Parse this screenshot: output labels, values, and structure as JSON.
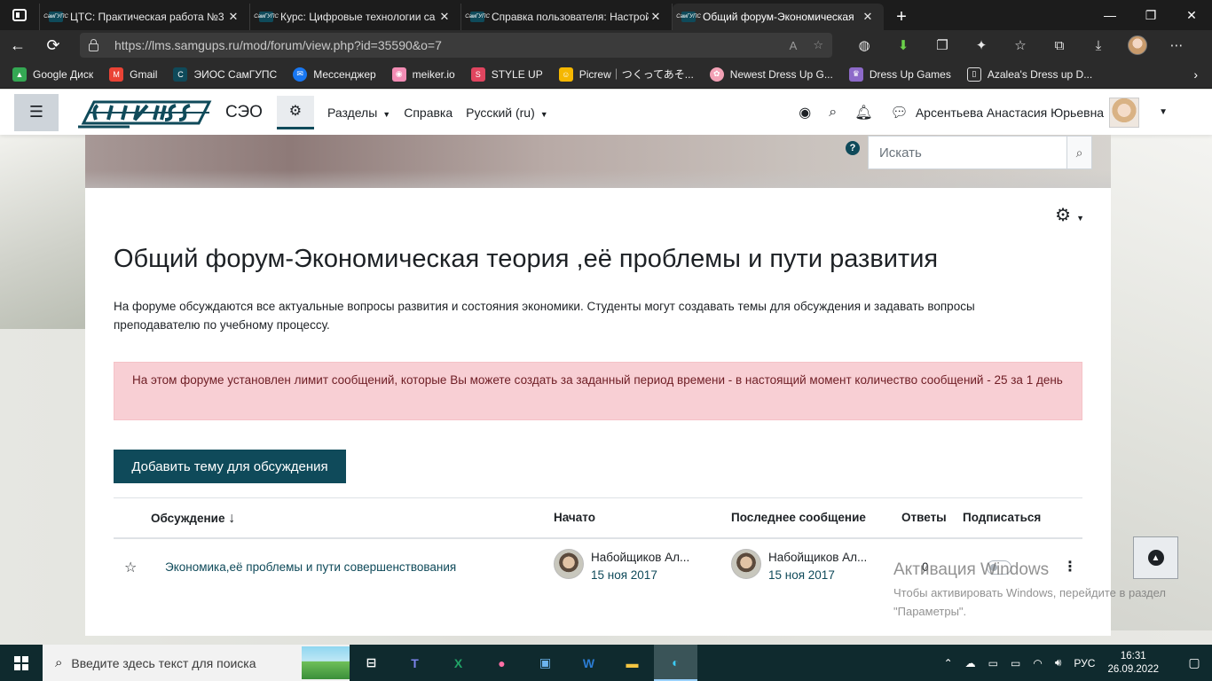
{
  "browser": {
    "tabs": [
      {
        "title": "ЦТС: Практическая работа №3",
        "active": false
      },
      {
        "title": "Курс: Цифровые технологии са",
        "active": false
      },
      {
        "title": "Справка пользователя: Настрой",
        "active": false
      },
      {
        "title": "Общий форум-Экономическая",
        "active": true
      }
    ],
    "favicon_text": "СамГУПС",
    "new_tab_symbol": "+",
    "window_controls": {
      "minimize": "—",
      "maximize": "❐",
      "close": "✕"
    },
    "address": {
      "url_host": "https://lms.samgups.ru",
      "url_path": "/mod/forum/view.php?id=35590&o=7",
      "read_aloud": "A"
    },
    "bookmarks": [
      {
        "label": "Google Диск",
        "icon": "drive-icon",
        "color": "#34a853"
      },
      {
        "label": "Gmail",
        "icon": "gmail-icon",
        "color": "#ea4335"
      },
      {
        "label": "ЭИОС СамГУПС",
        "icon": "samgups-icon",
        "color": "#0f4a5a"
      },
      {
        "label": "Мессенджер",
        "icon": "messenger-icon",
        "color": "#1877f2"
      },
      {
        "label": "meiker.io",
        "icon": "meiker-icon",
        "color": "#f28cb4"
      },
      {
        "label": "STYLE UP",
        "icon": "styleup-icon",
        "color": "#e0455f"
      },
      {
        "label": "Picrew｜つくってあそ...",
        "icon": "picrew-icon",
        "color": "#f5b700"
      },
      {
        "label": "Newest Dress Up G...",
        "icon": "dressup-icon",
        "color": "#f3a1b5"
      },
      {
        "label": "Dress Up Games",
        "icon": "dressup-games-icon",
        "color": "#8d6ac9"
      },
      {
        "label": "Azalea's Dress up D...",
        "icon": "page-icon",
        "color": "#2b2b2b"
      }
    ]
  },
  "moodle": {
    "site_name": "СЭО",
    "nav": {
      "sections": "Разделы",
      "help": "Справка",
      "language": "Русский (ru)"
    },
    "user_name": "Арсентьева Анастасия Юрьевна",
    "search_placeholder": "Искать",
    "forum": {
      "title": "Общий форум-Экономическая теория ,её проблемы и пути развития",
      "description": "На форуме обсуждаются все актуальные вопросы развития и состояния экономики. Студенты могут создавать темы для обсуждения и задавать вопросы преподавателю по учебному процессу.",
      "alert": "На этом форуме установлен лимит сообщений, которые Вы можете создать за заданный период времени - в настоящий момент количество сообщений - 25 за 1 день",
      "add_button": "Добавить тему для обсуждения",
      "columns": {
        "discussion": "Обсуждение",
        "sort_arrow": "↓",
        "started": "Начато",
        "last_post": "Последнее сообщение",
        "replies": "Ответы",
        "subscribe": "Подписаться"
      },
      "rows": [
        {
          "title": "Экономика,её проблемы и пути совершенствования",
          "started_by": "Набойщиков Ал...",
          "started_date": "15 ноя 2017",
          "last_by": "Набойщиков Ал...",
          "last_date": "15 ноя 2017",
          "replies": "0",
          "subscribed": false
        }
      ]
    }
  },
  "windows_activation": {
    "title": "Активация Windows",
    "text": "Чтобы активировать Windows, перейдите в раздел \"Параметры\"."
  },
  "taskbar": {
    "search_placeholder": "Введите здесь текст для поиска",
    "apps": [
      "task-view-icon",
      "teams-icon",
      "excel-icon",
      "paint3d-icon",
      "photos-icon",
      "word-icon",
      "explorer-icon",
      "edge-icon"
    ],
    "language": "РУС",
    "time": "16:31",
    "date": "26.09.2022"
  },
  "colors": {
    "brand": "#0f4a5a",
    "alert_bg": "#f8cfd4",
    "alert_text": "#6e1d24"
  }
}
